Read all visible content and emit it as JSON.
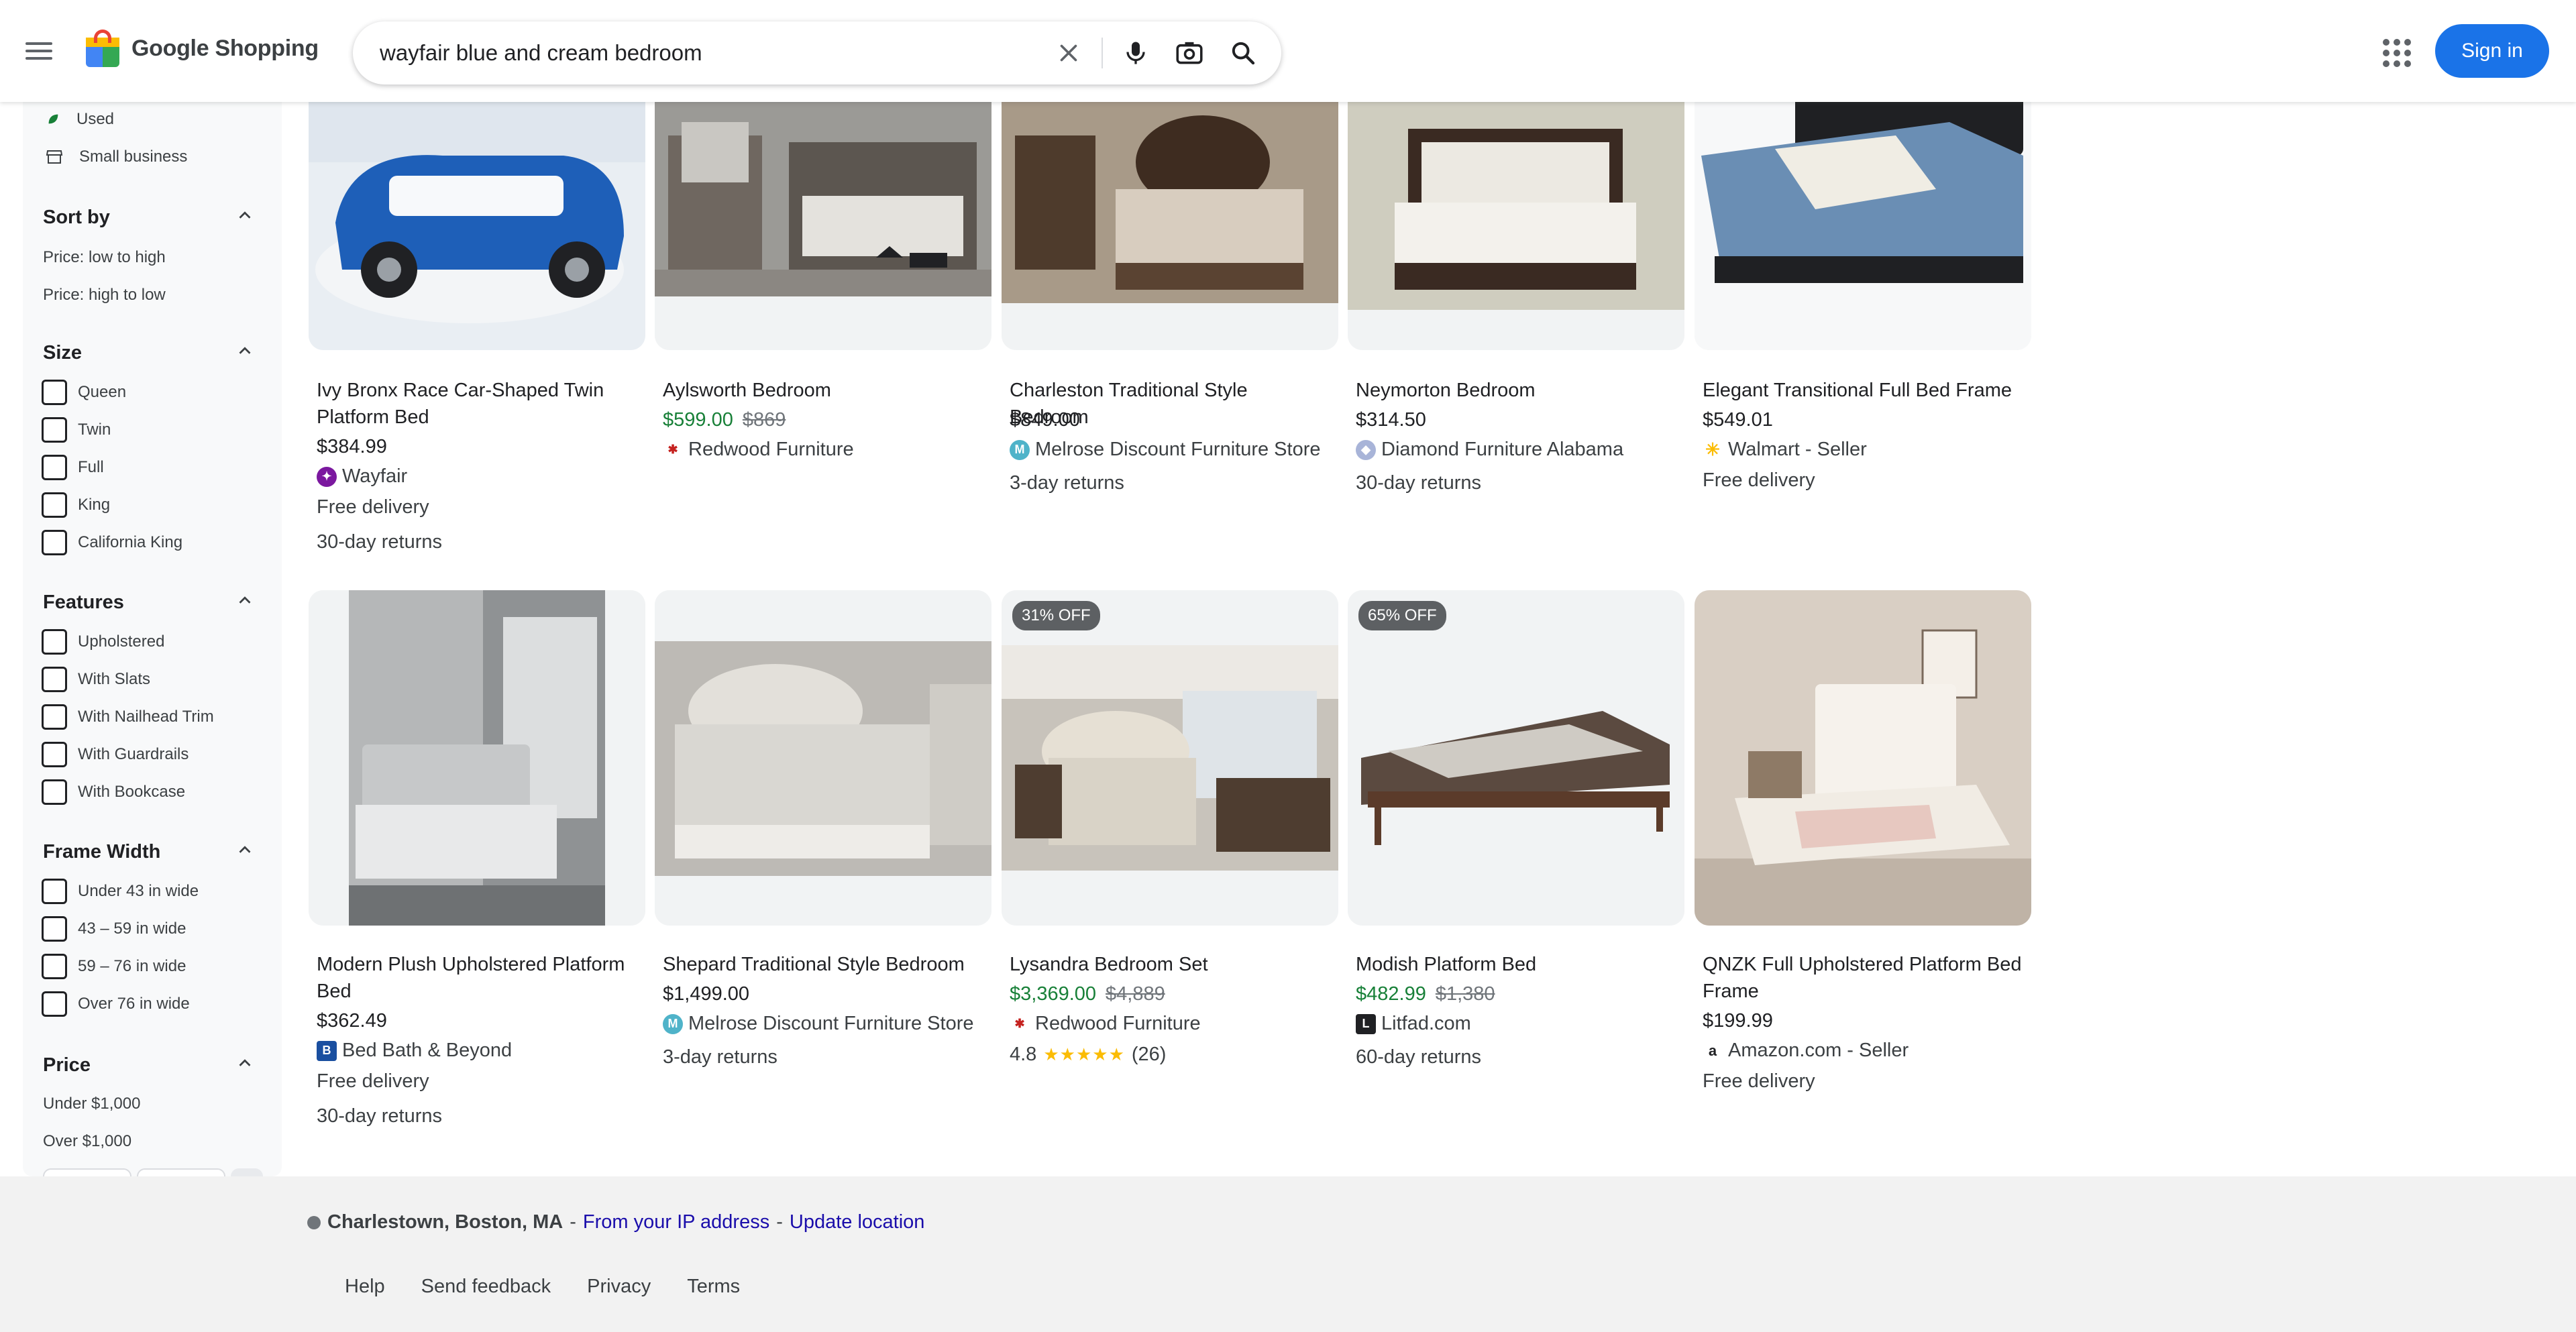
{
  "header": {
    "logo_text": "Google Shopping",
    "search_value": "wayfair blue and cream bedroom",
    "sign_in_label": "Sign in"
  },
  "sidebar": {
    "conditions": [
      {
        "label": "Used",
        "icon": "leaf-icon"
      },
      {
        "label": "Small business",
        "icon": "storefront-icon"
      }
    ],
    "sort_by": {
      "title": "Sort by",
      "options": [
        "Price: low to high",
        "Price: high to low"
      ]
    },
    "size": {
      "title": "Size",
      "options": [
        "Queen",
        "Twin",
        "Full",
        "King",
        "California King"
      ]
    },
    "features": {
      "title": "Features",
      "options": [
        "Upholstered",
        "With Slats",
        "With Nailhead Trim",
        "With Guardrails",
        "With Bookcase"
      ]
    },
    "frame_width": {
      "title": "Frame Width",
      "options": [
        "Under 43 in wide",
        "43 – 59 in wide",
        "59 – 76 in wide",
        "Over 76 in wide"
      ]
    },
    "price": {
      "title": "Price",
      "options": [
        "Under $1,000",
        "Over $1,000"
      ]
    }
  },
  "products": [
    {
      "title": "Ivy Bronx Race Car-Shaped Twin Platform Bed",
      "price": "$384.99",
      "was": "",
      "store": "Wayfair",
      "store_color": "#7b189f",
      "store_glyph": "✦",
      "lines": [
        "Free delivery",
        "30-day returns"
      ],
      "badge": "",
      "rating": "",
      "reviews": ""
    },
    {
      "title": "Aylsworth Bedroom",
      "price": "$599.00",
      "was": "$869",
      "store": "Redwood Furniture",
      "store_color": "#c5221f",
      "store_glyph": "✱",
      "lines": [],
      "badge": "",
      "rating": "",
      "reviews": ""
    },
    {
      "title": "Charleston Traditional Style Bedroom",
      "price": "$849.00",
      "was": "",
      "store": "Melrose Discount Furniture Store",
      "store_color": "#4fb3c9",
      "store_glyph": "M",
      "lines": [
        "3-day returns"
      ],
      "badge": "",
      "rating": "",
      "reviews": ""
    },
    {
      "title": "Neymorton Bedroom",
      "price": "$314.50",
      "was": "",
      "store": "Diamond Furniture Alabama",
      "store_color": "#a8b4d8",
      "store_glyph": "◆",
      "lines": [
        "30-day returns"
      ],
      "badge": "",
      "rating": "",
      "reviews": ""
    },
    {
      "title": "Elegant Transitional Full Bed Frame",
      "price": "$549.01",
      "was": "",
      "store": "Walmart - Seller",
      "store_color": "#fbbc04",
      "store_glyph": "✳",
      "lines": [
        "Free delivery"
      ],
      "badge": "",
      "rating": "",
      "reviews": ""
    },
    {
      "title": "Modern Plush Upholstered Platform Bed",
      "price": "$362.49",
      "was": "",
      "store": "Bed Bath & Beyond",
      "store_color": "#1a4fa0",
      "store_glyph": "B",
      "lines": [
        "Free delivery",
        "30-day returns"
      ],
      "badge": "",
      "rating": "",
      "reviews": ""
    },
    {
      "title": "Shepard Traditional Style Bedroom",
      "price": "$1,499.00",
      "was": "",
      "store": "Melrose Discount Furniture Store",
      "store_color": "#4fb3c9",
      "store_glyph": "M",
      "lines": [
        "3-day returns"
      ],
      "badge": "",
      "rating": "",
      "reviews": ""
    },
    {
      "title": "Lysandra Bedroom Set",
      "price": "$3,369.00",
      "was": "$4,889",
      "store": "Redwood Furniture",
      "store_color": "#c5221f",
      "store_glyph": "✱",
      "lines": [],
      "badge": "31% OFF",
      "rating": "4.8",
      "reviews": "(26)"
    },
    {
      "title": "Modish Platform Bed",
      "price": "$482.99",
      "was": "$1,380",
      "store": "Litfad.com",
      "store_color": "#202124",
      "store_glyph": "L",
      "lines": [
        "60-day returns"
      ],
      "badge": "65% OFF",
      "rating": "",
      "reviews": ""
    },
    {
      "title": "QNZK Full Upholstered Platform Bed Frame",
      "price": "$199.99",
      "was": "",
      "store": "Amazon.com - Seller",
      "store_color": "#ffffff",
      "store_glyph": "a",
      "lines": [
        "Free delivery"
      ],
      "badge": "",
      "rating": "",
      "reviews": ""
    }
  ],
  "footer": {
    "location": "Charlestown, Boston, MA",
    "sep1": " - ",
    "ip_link": "From your IP address",
    "sep2": " - ",
    "update_link": "Update location",
    "links": [
      "Help",
      "Send feedback",
      "Privacy",
      "Terms"
    ]
  },
  "colors": {
    "accent": "#1a73e8",
    "sale_price": "#188038",
    "link": "#1a0dab"
  }
}
